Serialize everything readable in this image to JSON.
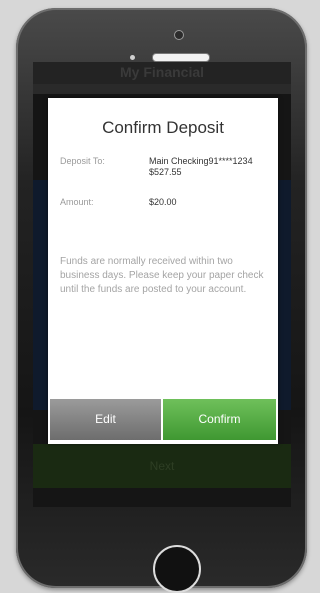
{
  "background_app": {
    "title": "My Financial",
    "bottom_button": "Next"
  },
  "modal": {
    "title": "Confirm Deposit",
    "deposit_to_label": "Deposit To:",
    "deposit_to_account": "Main Checking91****1234",
    "deposit_to_balance": "$527.55",
    "amount_label": "Amount:",
    "amount_value": "$20.00",
    "info_text": "Funds are normally received within two business days. Please keep your paper check until the funds are posted to your account.",
    "edit_label": "Edit",
    "confirm_label": "Confirm"
  },
  "colors": {
    "confirm_green": "#4caf3c",
    "edit_gray": "#7f7f7f"
  }
}
